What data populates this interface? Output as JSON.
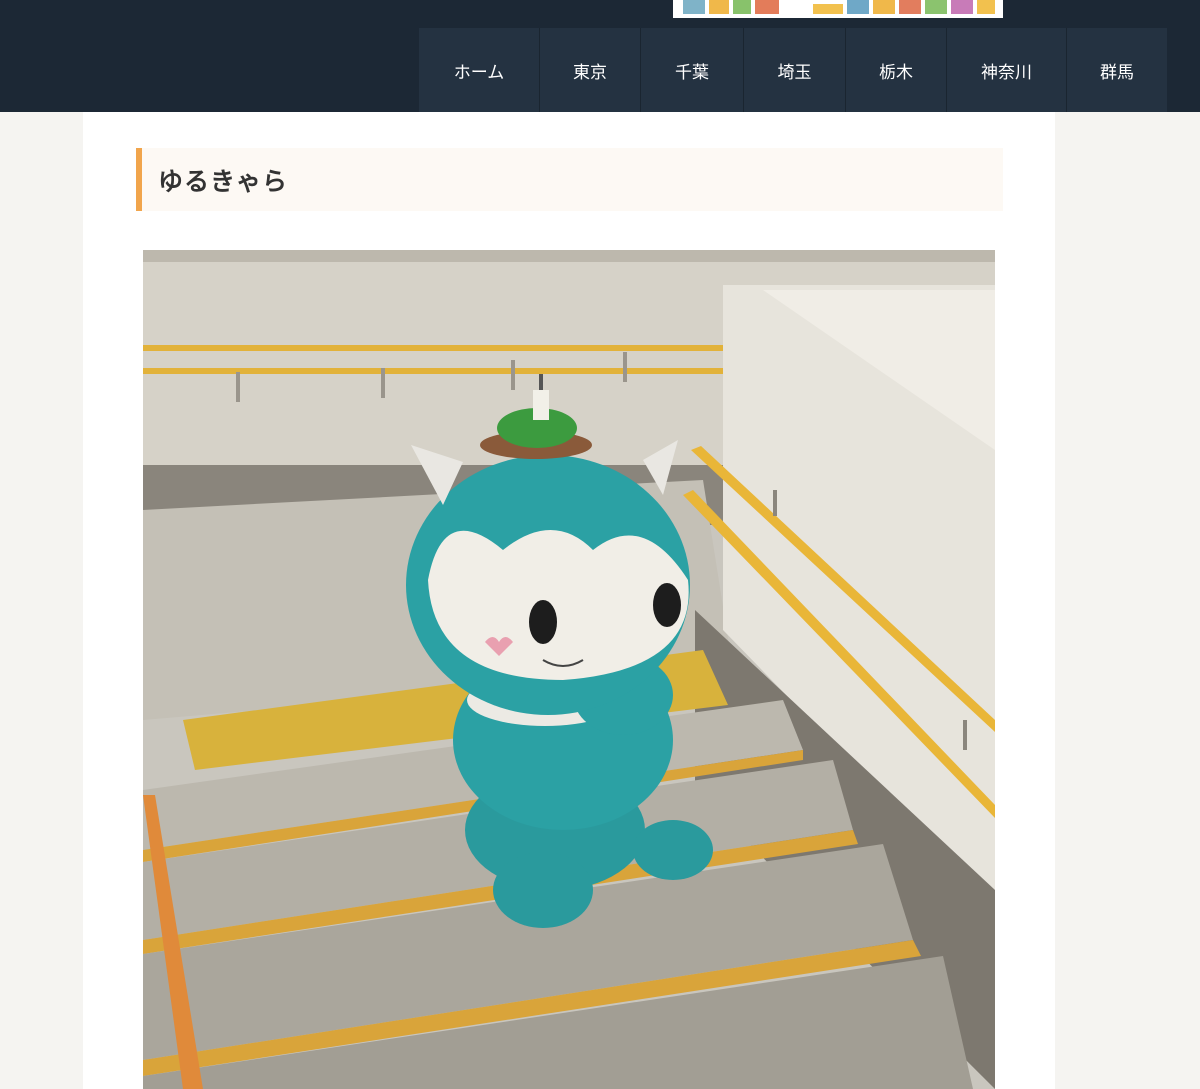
{
  "nav": {
    "items": [
      {
        "label": "ホーム"
      },
      {
        "label": "東京"
      },
      {
        "label": "千葉"
      },
      {
        "label": "埼玉"
      },
      {
        "label": "栃木"
      },
      {
        "label": "神奈川"
      },
      {
        "label": "群馬"
      }
    ]
  },
  "article": {
    "heading": "ゆるきゃら"
  },
  "colors": {
    "header_bg": "#1c2835",
    "nav_item_bg": "#243241",
    "heading_accent": "#f1a54c",
    "heading_bg": "#fdf9f4"
  }
}
